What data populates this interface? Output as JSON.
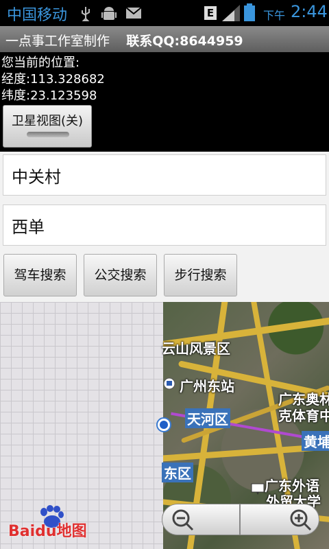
{
  "status": {
    "carrier": "中国移动",
    "network": "E",
    "time_prefix": "下午",
    "time": "2:44"
  },
  "title": {
    "maker": "一点事工作室制作",
    "contact_label": "联系QQ:",
    "contact_value": "8644959"
  },
  "location": {
    "heading": "您当前的位置:",
    "lng_label": "经度:",
    "lng": "113.328682",
    "lat_label": "纬度:",
    "lat": "23.123598"
  },
  "satellite_button": {
    "label": "卫星视图(关)"
  },
  "search": {
    "from": "中关村",
    "to": "西单"
  },
  "buttons": {
    "drive": "驾车搜索",
    "bus": "公交搜索",
    "walk": "步行搜索"
  },
  "map": {
    "labels": [
      "云山风景区",
      "广州东站",
      "天河区",
      "广东奥林",
      "克体育中",
      "黄埔",
      "东区",
      "广东外语",
      "外贸大学"
    ],
    "logo_text": "Baidu地图"
  },
  "colors": {
    "status_blue": "#3a95dc",
    "title_gray": "#6e6e6e",
    "road": "#d8b33a",
    "district_label": "#3a72b9"
  }
}
